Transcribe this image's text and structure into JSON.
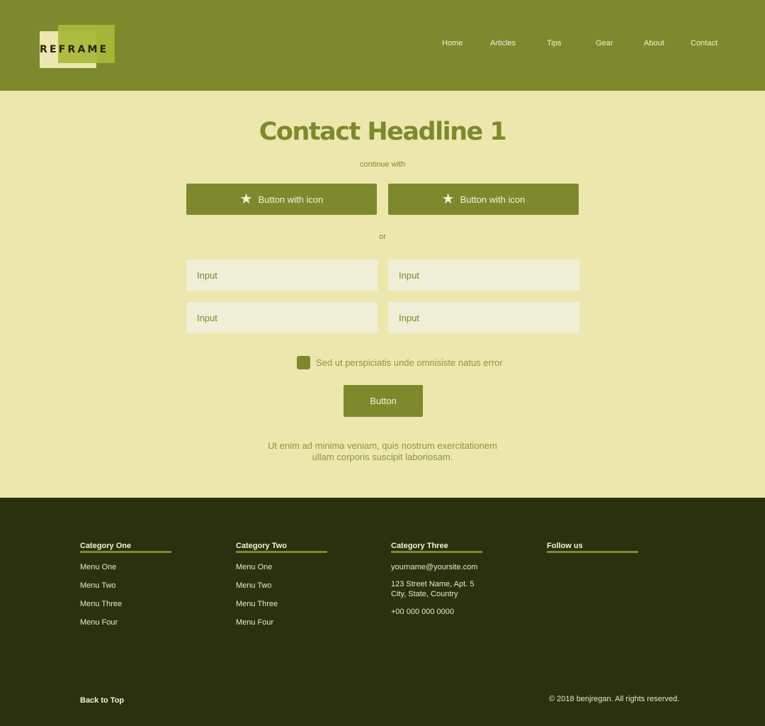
{
  "header": {
    "logo_text": "REFRAME",
    "nav": [
      "Home",
      "Articles",
      "Tips",
      "Gear",
      "About",
      "Contact"
    ]
  },
  "main": {
    "headline": "Contact Headline 1",
    "continue_with": "continue with",
    "icon_buttons": [
      {
        "label": "Button with icon",
        "icon": "star-icon"
      },
      {
        "label": "Button with icon",
        "icon": "star-icon"
      }
    ],
    "or_text": "or",
    "inputs": [
      {
        "placeholder": "Input",
        "value": ""
      },
      {
        "placeholder": "Input",
        "value": ""
      },
      {
        "placeholder": "Input",
        "value": ""
      },
      {
        "placeholder": "Input",
        "value": ""
      }
    ],
    "checkbox_label": "Sed ut perspiciatis unde omnisiste natus error",
    "submit_label": "Button",
    "note_line1": "Ut enim ad minima veniam, quis nostrum exercitationem",
    "note_line2": "ullam corporis suscipit laboriosam."
  },
  "footer": {
    "columns": [
      {
        "title": "Category One",
        "items": [
          "Menu One",
          "Menu Two",
          "Menu Three",
          "Menu Four"
        ]
      },
      {
        "title": "Category Two",
        "items": [
          "Menu One",
          "Menu Two",
          "Menu Three",
          "Menu Four"
        ]
      },
      {
        "title": "Category Three",
        "email": "yourname@yoursite.com",
        "address_line1": "123 Street Name, Apt. 5",
        "address_line2": "City, State, Country",
        "phone": "+00 000 000 0000"
      },
      {
        "title": "Follow us"
      }
    ],
    "back_to_top": "Back to Top",
    "copyright": "© 2018 benjregan. All rights reserved."
  },
  "colors": {
    "header_bg": "#7d892d",
    "main_bg": "#ede7ad",
    "footer_bg": "#2b300f",
    "accent": "#7d892d",
    "input_bg": "#efefd7"
  }
}
